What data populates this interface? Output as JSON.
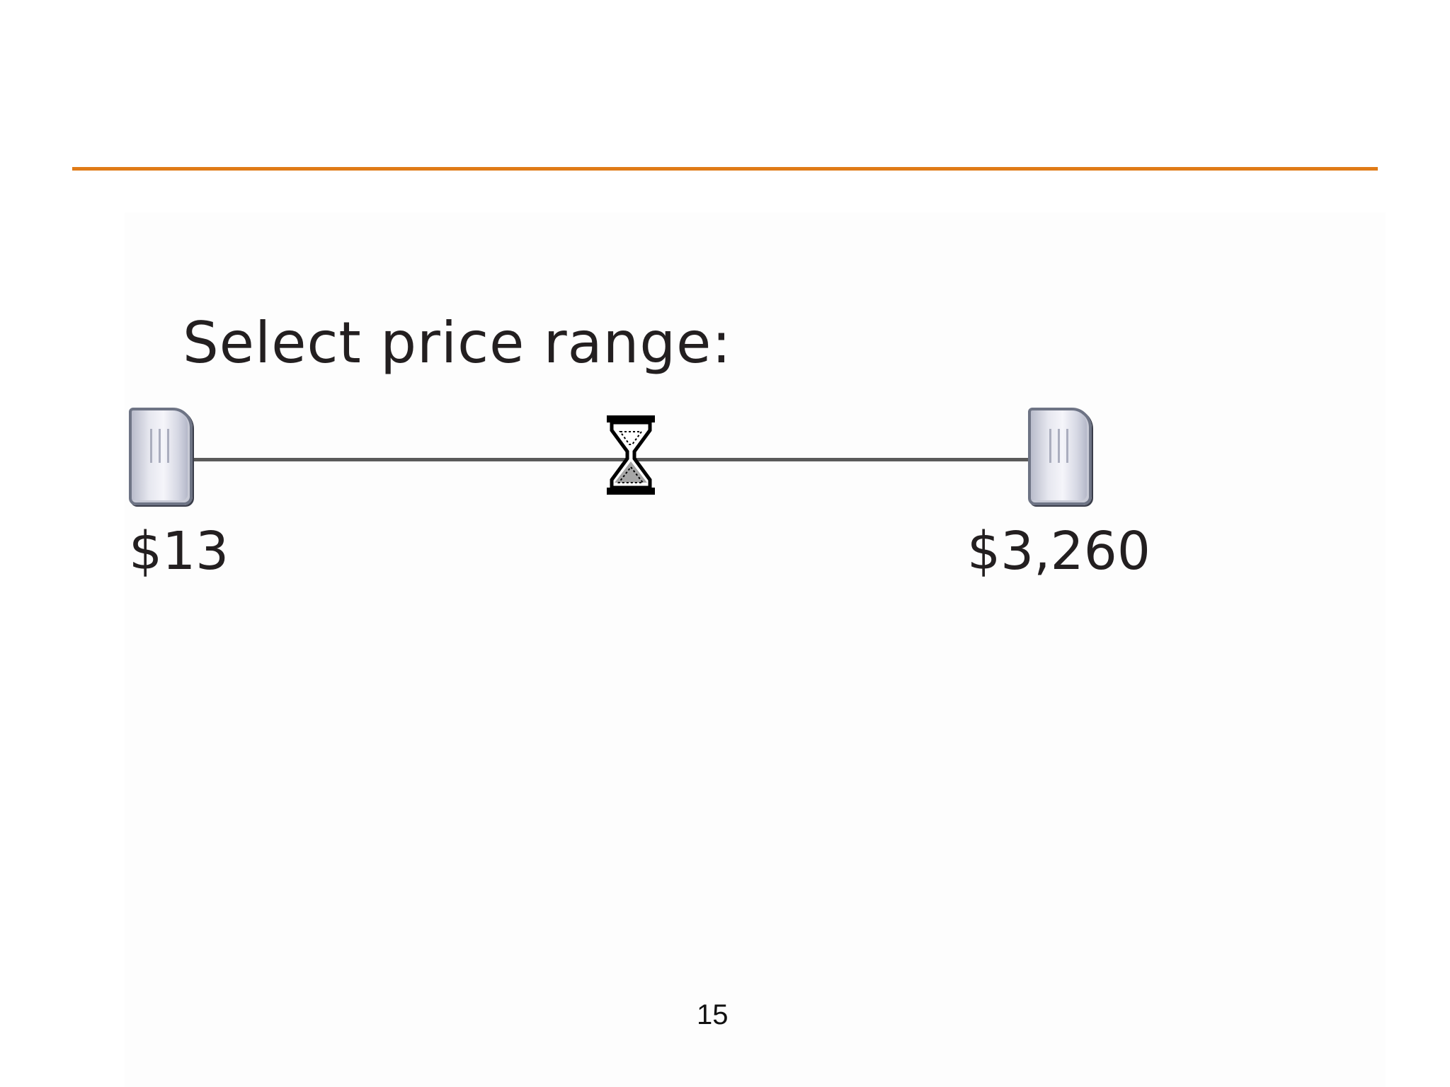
{
  "slide": {
    "page_number": "15",
    "accent_color": "#e07b17"
  },
  "price_slider": {
    "label": "Select price range:",
    "min_label": "$13",
    "max_label": "$3,260",
    "min_thumb_icon": "slider-thumb-icon",
    "max_thumb_icon": "slider-thumb-icon",
    "busy_icon": "hourglass-icon"
  }
}
